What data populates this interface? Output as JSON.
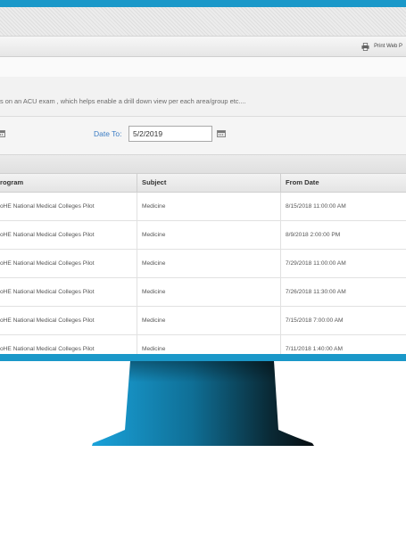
{
  "toolbar": {
    "print_label": "Print Web P"
  },
  "description": "s on an ACU exam , which helps enable a drill down view per each area/group etc....",
  "filters": {
    "date_to_label": "Date To:",
    "date_to_value": "5/2/2019"
  },
  "grid": {
    "columns": [
      "rogram",
      "Subject",
      "From Date"
    ],
    "rows": [
      {
        "program": "oHE National Medical Colleges Pilot",
        "subject": "Medicine",
        "from_date": "8/15/2018 11:00:00 AM"
      },
      {
        "program": "oHE National Medical Colleges Pilot",
        "subject": "Medicine",
        "from_date": "8/9/2018 2:00:00 PM"
      },
      {
        "program": "oHE National Medical Colleges Pilot",
        "subject": "Medicine",
        "from_date": "7/29/2018 11:00:00 AM"
      },
      {
        "program": "oHE National Medical Colleges Pilot",
        "subject": "Medicine",
        "from_date": "7/26/2018 11:30:00 AM"
      },
      {
        "program": "oHE National Medical Colleges Pilot",
        "subject": "Medicine",
        "from_date": "7/15/2018 7:00:00 AM"
      },
      {
        "program": "oHE National Medical Colleges Pilot",
        "subject": "Medicine",
        "from_date": "7/11/2018 1:40:00 AM"
      }
    ]
  },
  "colors": {
    "bezel": "#1a98c9",
    "stand_light": "#1a9fd6",
    "stand_dark": "#0a1419",
    "link_blue": "#3c7dc4"
  },
  "icons": {
    "print": "printer-icon",
    "calendar": "calendar-icon"
  }
}
